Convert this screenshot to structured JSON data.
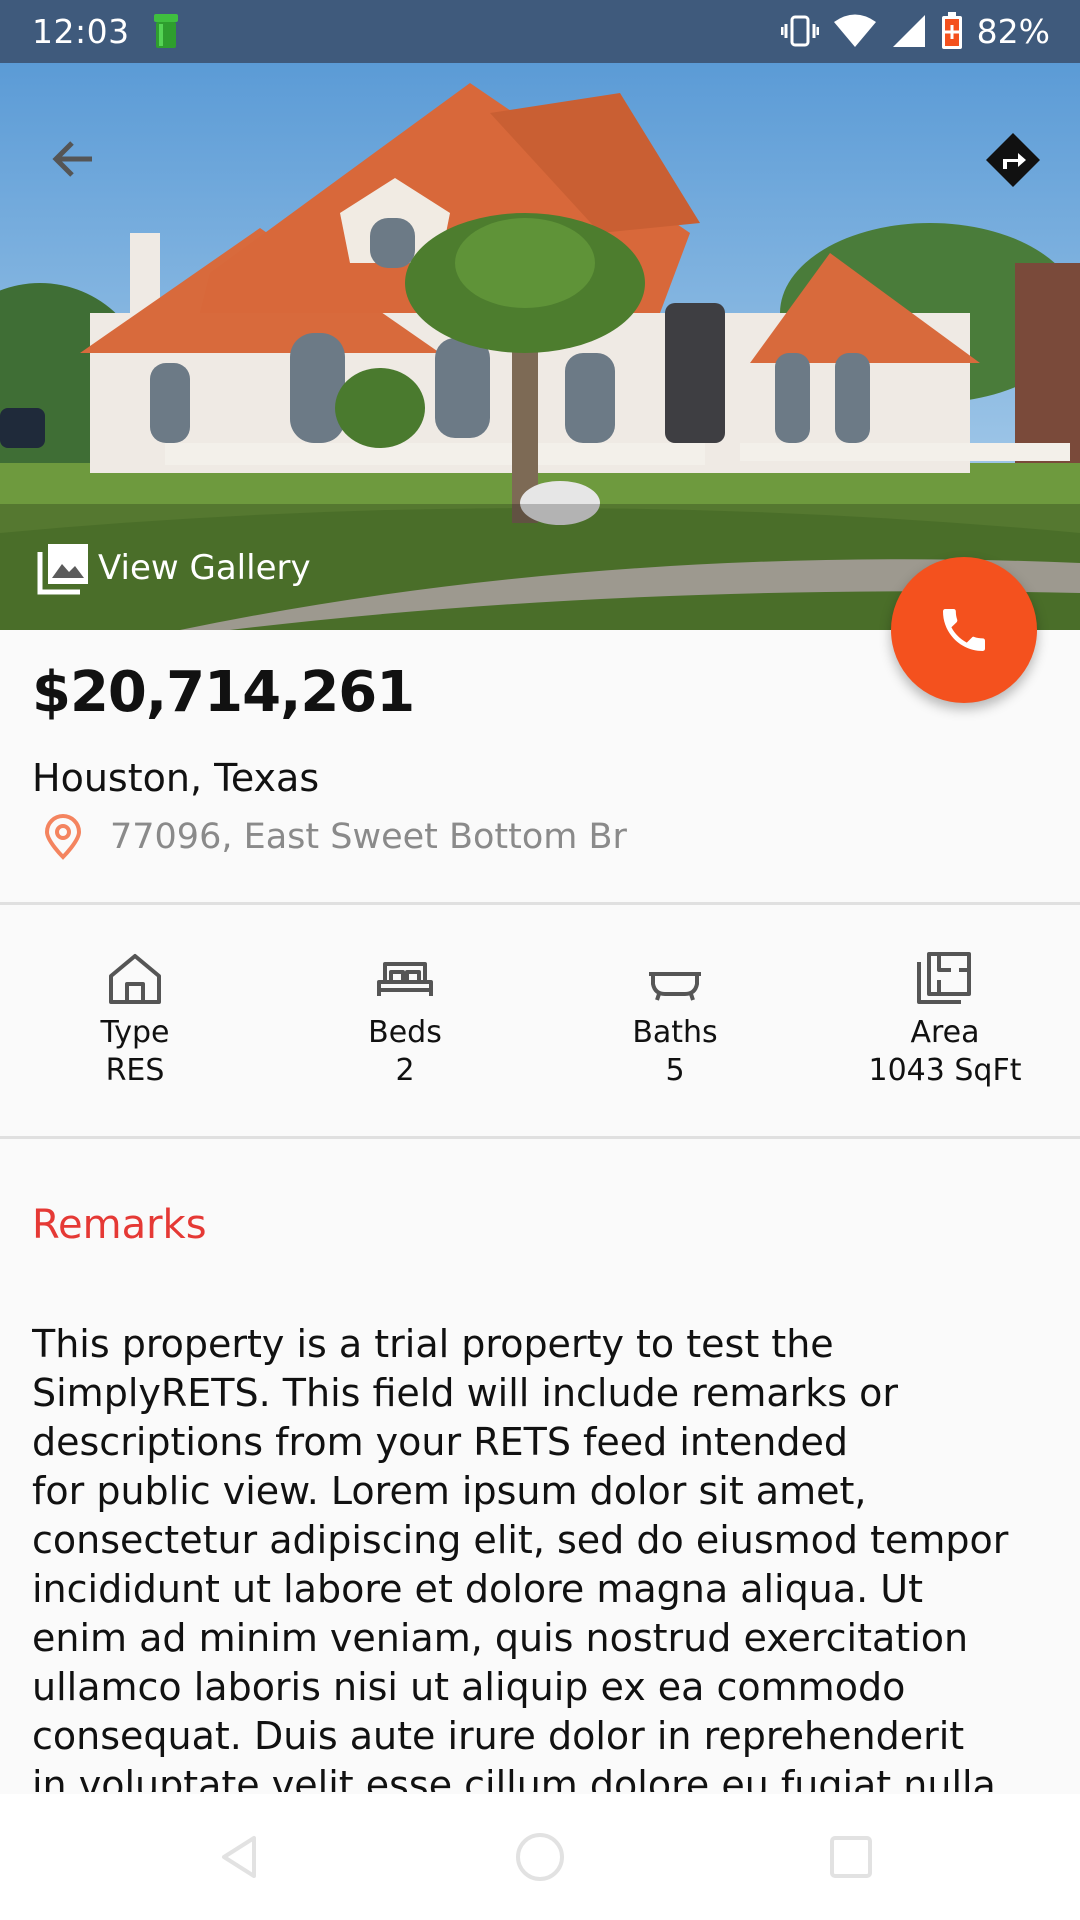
{
  "status_bar": {
    "time": "12:03",
    "battery_percent": "82%",
    "icons": [
      "app-notification-icon",
      "vibrate-icon",
      "wifi-icon",
      "cell-signal-icon",
      "battery-icon"
    ]
  },
  "hero": {
    "gallery_label": "View Gallery",
    "icons": [
      "back-arrow-icon",
      "directions-icon",
      "gallery-icon"
    ]
  },
  "fab": {
    "icon": "phone-icon",
    "color": "#f4511e"
  },
  "listing": {
    "price": "$20,714,261",
    "city": "Houston, Texas",
    "address": "77096, East Sweet Bottom Br"
  },
  "features": [
    {
      "label": "Type",
      "value": "RES",
      "icon": "house-icon"
    },
    {
      "label": "Beds",
      "value": "2",
      "icon": "bed-icon"
    },
    {
      "label": "Baths",
      "value": "5",
      "icon": "bathtub-icon"
    },
    {
      "label": "Area",
      "value": "1043 SqFt",
      "icon": "floorplan-icon"
    }
  ],
  "remarks": {
    "title": "Remarks",
    "title_color": "#e53935",
    "body": "This property is a trial property to test the\nSimplyRETS. This field will include remarks or\ndescriptions from your RETS feed intended\nfor public view. Lorem ipsum dolor sit amet,\nconsectetur adipiscing elit, sed do eiusmod tempor\nincididunt ut labore et dolore magna aliqua. Ut\nenim ad minim veniam, quis nostrud exercitation\nullamco laboris nisi ut aliquip ex ea commodo\nconsequat. Duis aute irure dolor in reprehenderit\nin voluptate velit esse cillum dolore eu fugiat nulla"
  },
  "nav_bar": {
    "icons": [
      "back-nav-icon",
      "home-nav-icon",
      "recents-nav-icon"
    ]
  }
}
